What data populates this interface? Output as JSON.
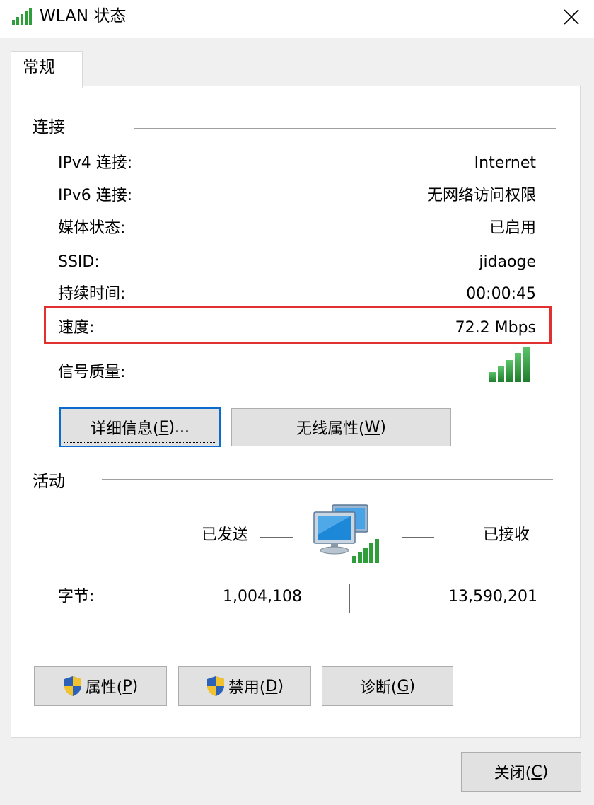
{
  "window": {
    "title": "WLAN 状态",
    "close_label": "✕"
  },
  "tabs": [
    {
      "label": "常规",
      "selected": true
    }
  ],
  "connection": {
    "section_title": "连接",
    "rows": [
      {
        "label": "IPv4 连接:",
        "value": "Internet"
      },
      {
        "label": "IPv6 连接:",
        "value": "无网络访问权限"
      },
      {
        "label": "媒体状态:",
        "value": "已启用"
      },
      {
        "label": "SSID:",
        "value": "jidaoge"
      },
      {
        "label": "持续时间:",
        "value": "00:00:45"
      },
      {
        "label": "速度:",
        "value": "72.2 Mbps"
      }
    ],
    "signal_label": "信号质量:",
    "signal_bars_lit": 5,
    "signal_bars_total": 5,
    "details_button": {
      "label": "详细信息(",
      "hotkey": "E",
      "suffix": ")..."
    },
    "wireless_button": {
      "label": "无线属性(",
      "hotkey": "W",
      "suffix": ")"
    }
  },
  "activity": {
    "section_title": "活动",
    "sent_label": "已发送",
    "received_label": "已接收",
    "bytes_label": "字节:",
    "bytes_sent": "1,004,108",
    "bytes_received": "13,590,201"
  },
  "buttons": {
    "properties": {
      "label": "属性(",
      "hotkey": "P",
      "suffix": ")"
    },
    "disable": {
      "label": "禁用(",
      "hotkey": "D",
      "suffix": ")"
    },
    "diagnose": {
      "label": "诊断(",
      "hotkey": "G",
      "suffix": ")"
    },
    "close": {
      "label": "关闭(",
      "hotkey": "C",
      "suffix": ")"
    }
  },
  "colors": {
    "signal_green": "#2e9e3a",
    "highlight_red": "#e03030",
    "focus_blue": "#0a6ccc"
  }
}
